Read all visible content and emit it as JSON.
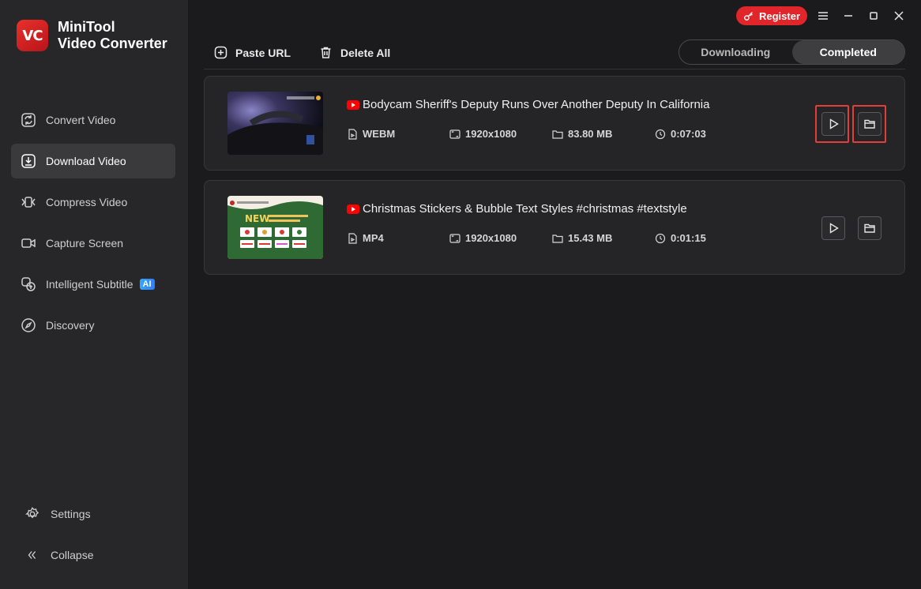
{
  "app": {
    "logo_mark": "VC",
    "name_line1": "MiniTool",
    "name_line2": "Video Converter"
  },
  "sidebar": {
    "items": [
      {
        "label": "Convert Video",
        "icon": "convert-icon"
      },
      {
        "label": "Download Video",
        "icon": "download-icon",
        "active": true
      },
      {
        "label": "Compress Video",
        "icon": "compress-icon"
      },
      {
        "label": "Capture Screen",
        "icon": "camera-icon"
      },
      {
        "label": "Intelligent Subtitle",
        "icon": "subtitle-icon",
        "badge": "AI"
      },
      {
        "label": "Discovery",
        "icon": "compass-icon"
      }
    ],
    "settings_label": "Settings",
    "collapse_label": "Collapse"
  },
  "titlebar": {
    "register_label": "Register"
  },
  "toolbar": {
    "paste_url_label": "Paste URL",
    "delete_all_label": "Delete All"
  },
  "tabs": [
    {
      "label": "Downloading",
      "active": false
    },
    {
      "label": "Completed",
      "active": true
    }
  ],
  "downloads": [
    {
      "title": "Bodycam Sheriff's Deputy Runs Over Another Deputy In California",
      "format": "WEBM",
      "resolution": "1920x1080",
      "size": "83.80 MB",
      "duration": "0:07:03"
    },
    {
      "title": "Christmas Stickers & Bubble Text Styles #christmas #textstyle",
      "format": "MP4",
      "resolution": "1920x1080",
      "size": "15.43 MB",
      "duration": "0:01:15",
      "thumb_text": "NEW"
    }
  ],
  "colors": {
    "accent": "#e0252b",
    "sidebar_bg": "#272729",
    "main_bg": "#1b1b1d",
    "highlight": "#e0403a"
  }
}
